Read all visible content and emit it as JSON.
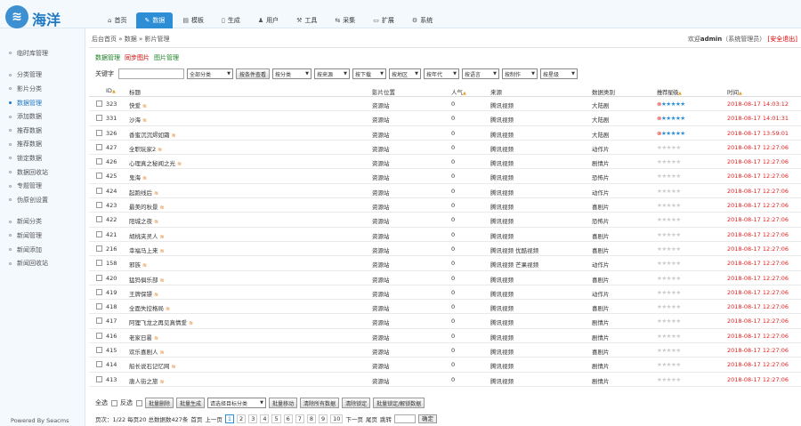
{
  "logo": {
    "glyph": "≋",
    "text": "海洋"
  },
  "nav_tabs": [
    {
      "label": "首页",
      "icon": "home-icon",
      "glyph": "⌂",
      "active": false
    },
    {
      "label": "数据",
      "icon": "edit-icon",
      "glyph": "✎",
      "active": true
    },
    {
      "label": "模板",
      "icon": "template-icon",
      "glyph": "▤",
      "active": false
    },
    {
      "label": "生成",
      "icon": "file-icon",
      "glyph": "▯",
      "active": false
    },
    {
      "label": "用户",
      "icon": "user-icon",
      "glyph": "♟",
      "active": false
    },
    {
      "label": "工具",
      "icon": "tool-icon",
      "glyph": "⚒",
      "active": false
    },
    {
      "label": "采集",
      "icon": "collect-icon",
      "glyph": "⇆",
      "active": false
    },
    {
      "label": "扩展",
      "icon": "folder-icon",
      "glyph": "▭",
      "active": false
    },
    {
      "label": "系统",
      "icon": "gear-icon",
      "glyph": "⚙",
      "active": false
    }
  ],
  "sidebar": {
    "group1": [
      "临时库管理"
    ],
    "group2": [
      "分类管理",
      "影片分类",
      "数据管理",
      "添加数据",
      "推荐数据",
      "推荐数据",
      "锁定数据",
      "数据回收站",
      "专题管理",
      "伪原创设置"
    ],
    "group2_active": 2,
    "group3": [
      "新闻分类",
      "新闻管理",
      "新闻添加",
      "新闻回收站"
    ],
    "powered": "Powered By Seacms"
  },
  "breadcrumb": "后台首页 » 数据 » 影片管理",
  "user": {
    "prefix": "欢迎",
    "name": "admin",
    "role": "（系统管理员）",
    "logout": "[安全退出]"
  },
  "subtabs": {
    "manage": "数据管理",
    "sync": "同步图片",
    "pic": "图片管理"
  },
  "filter": {
    "keyword_label": "关键字",
    "category": "全部分类",
    "search_btn": "按条件查看",
    "selects": [
      "按分类",
      "按来源",
      "按下载",
      "按地区",
      "按年代",
      "按语言",
      "按制作",
      "按星级"
    ]
  },
  "table": {
    "headers": {
      "id": "ID",
      "title": "标题",
      "loc": "影片位置",
      "pop": "人气",
      "src": "来源",
      "type": "数据类别",
      "rec": "推荐星级",
      "time": "时间"
    },
    "rows": [
      {
        "id": "323",
        "title": "快爱",
        "loc": "资源站",
        "pop": "0",
        "src": "腾讯视频",
        "type": "大陆剧",
        "stars": 5,
        "x": true,
        "time": "2018-08-17 14:03:12"
      },
      {
        "id": "331",
        "title": "沙海",
        "loc": "资源站",
        "pop": "0",
        "src": "腾讯视频",
        "type": "大陆剧",
        "stars": 5,
        "x": true,
        "time": "2018-08-17 14:01:31"
      },
      {
        "id": "326",
        "title": "香蜜沉沉烬如霜",
        "loc": "资源站",
        "pop": "0",
        "src": "腾讯视频",
        "type": "大陆剧",
        "stars": 5,
        "x": true,
        "time": "2018-08-17 13:59:01"
      },
      {
        "id": "427",
        "title": "全职玩家2",
        "loc": "资源站",
        "pop": "0",
        "src": "腾讯视频",
        "type": "动作片",
        "stars": 0,
        "x": false,
        "time": "2018-08-17 12:27:06"
      },
      {
        "id": "426",
        "title": "心理真之秘闻之光",
        "loc": "资源站",
        "pop": "0",
        "src": "腾讯视频",
        "type": "剧情片",
        "stars": 0,
        "x": false,
        "time": "2018-08-17 12:27:06"
      },
      {
        "id": "425",
        "title": "鬼海",
        "loc": "资源站",
        "pop": "0",
        "src": "腾讯视频",
        "type": "恐怖片",
        "stars": 0,
        "x": false,
        "time": "2018-08-17 12:27:06"
      },
      {
        "id": "424",
        "title": "起跑线后",
        "loc": "资源站",
        "pop": "0",
        "src": "腾讯视频",
        "type": "动作片",
        "stars": 0,
        "x": false,
        "time": "2018-08-17 12:27:06"
      },
      {
        "id": "423",
        "title": "最美的秋景",
        "loc": "资源站",
        "pop": "0",
        "src": "腾讯视频",
        "type": "喜剧片",
        "stars": 0,
        "x": false,
        "time": "2018-08-17 12:27:06"
      },
      {
        "id": "422",
        "title": "阳城之夜",
        "loc": "资源站",
        "pop": "0",
        "src": "腾讯视频",
        "type": "恐怖片",
        "stars": 0,
        "x": false,
        "time": "2018-08-17 12:27:06"
      },
      {
        "id": "421",
        "title": "胡桃夹灵人",
        "loc": "资源站",
        "pop": "0",
        "src": "腾讯视频",
        "type": "喜剧片",
        "stars": 0,
        "x": false,
        "time": "2018-08-17 12:27:06"
      },
      {
        "id": "216",
        "title": "幸福马上来",
        "loc": "资源站",
        "pop": "0",
        "src": "腾讯视频 优酷视频",
        "type": "喜剧片",
        "stars": 0,
        "x": false,
        "time": "2018-08-17 12:27:06"
      },
      {
        "id": "158",
        "title": "邪族",
        "loc": "资源站",
        "pop": "0",
        "src": "腾讯视频 芒果视频",
        "type": "动作片",
        "stars": 0,
        "x": false,
        "time": "2018-08-17 12:27:06"
      },
      {
        "id": "420",
        "title": "猛犸俱乐部",
        "loc": "资源站",
        "pop": "0",
        "src": "腾讯视频",
        "type": "喜剧片",
        "stars": 0,
        "x": false,
        "time": "2018-08-17 12:27:06"
      },
      {
        "id": "419",
        "title": "王牌保镖",
        "loc": "资源站",
        "pop": "0",
        "src": "腾讯视频",
        "type": "动作片",
        "stars": 0,
        "x": false,
        "time": "2018-08-17 12:27:06"
      },
      {
        "id": "418",
        "title": "全面失控格局",
        "loc": "资源站",
        "pop": "0",
        "src": "腾讯视频",
        "type": "喜剧片",
        "stars": 0,
        "x": false,
        "time": "2018-08-17 12:27:06"
      },
      {
        "id": "417",
        "title": "阿狸飞龙之再见真情爱",
        "loc": "资源站",
        "pop": "0",
        "src": "腾讯视频",
        "type": "剧情片",
        "stars": 0,
        "x": false,
        "time": "2018-08-17 12:27:06"
      },
      {
        "id": "416",
        "title": "老家日晷",
        "loc": "资源站",
        "pop": "0",
        "src": "腾讯视频",
        "type": "剧情片",
        "stars": 0,
        "x": false,
        "time": "2018-08-17 12:27:06"
      },
      {
        "id": "415",
        "title": "欢乐喜剧人",
        "loc": "资源站",
        "pop": "0",
        "src": "腾讯视频",
        "type": "喜剧片",
        "stars": 0,
        "x": false,
        "time": "2018-08-17 12:27:06"
      },
      {
        "id": "414",
        "title": "船长说石记忆网",
        "loc": "资源站",
        "pop": "0",
        "src": "腾讯视频",
        "type": "剧情片",
        "stars": 0,
        "x": false,
        "time": "2018-08-17 12:27:06"
      },
      {
        "id": "413",
        "title": "唐人街之旅",
        "loc": "资源站",
        "pop": "0",
        "src": "腾讯视频",
        "type": "剧情片",
        "stars": 0,
        "x": false,
        "time": "2018-08-17 12:27:06"
      }
    ]
  },
  "batch": {
    "all_label": "全选",
    "invert_label": "反选",
    "buttons": [
      "批量删除",
      "批量生成",
      "批量移动",
      "清除所有数据",
      "清除锁定",
      "批量锁定/解锁数据"
    ],
    "move_select": "请选择目标分类"
  },
  "pager": {
    "info": "页次：1/22 每页20 总数据数427条",
    "first": "首页",
    "prev": "上一页",
    "pages": [
      "1",
      "2",
      "3",
      "4",
      "5",
      "6",
      "7",
      "8",
      "9",
      "10"
    ],
    "current": "1",
    "next": "下一页",
    "last": "尾页",
    "jump_label": "跳转",
    "go": "确定"
  },
  "colors": {
    "accent": "#2d8ed6",
    "time": "#dd2222",
    "logout": "#dd0000"
  }
}
